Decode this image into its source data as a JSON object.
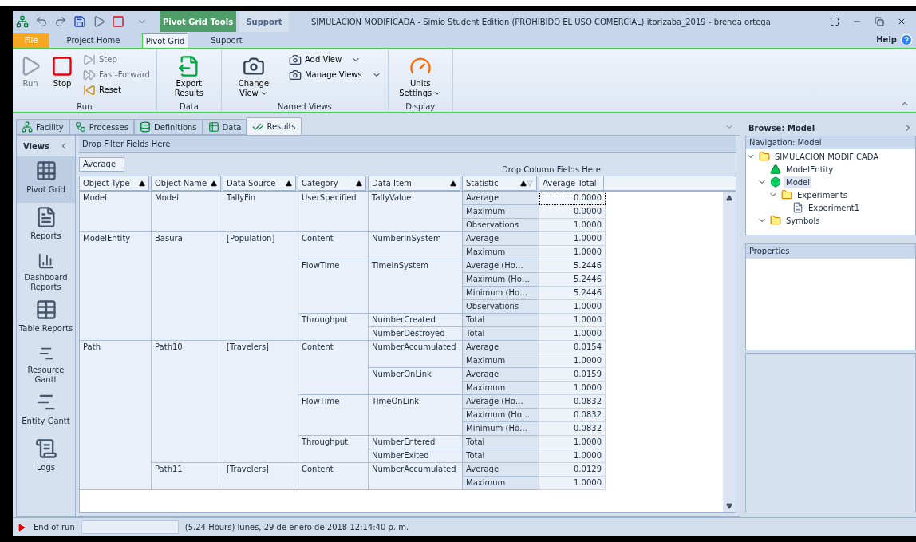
{
  "window": {
    "title": "SIMULACION MODIFICADA - Simio Student Edition (PROHIBIDO EL USO COMERCIAL) itorizaba_2019 - brenda ortega",
    "context_tabs": [
      "Pivot Grid Tools",
      "Support"
    ],
    "help": "Help"
  },
  "ribbon_tabs": [
    {
      "label": "File",
      "kind": "file",
      "selected": false
    },
    {
      "label": "Project Home",
      "kind": "tab",
      "selected": false
    },
    {
      "label": "Pivot Grid",
      "kind": "tab",
      "selected": true
    },
    {
      "label": "Support",
      "kind": "tab",
      "selected": false
    }
  ],
  "ribbon_groups": [
    {
      "label": "Run",
      "items": [
        {
          "kind": "big",
          "label": "Run",
          "disabled": true
        },
        {
          "kind": "big",
          "label": "Stop",
          "disabled": false
        },
        {
          "kind": "stack",
          "items": [
            {
              "label": "Step",
              "disabled": true
            },
            {
              "label": "Fast-Forward",
              "disabled": true
            },
            {
              "label": "Reset",
              "disabled": false
            }
          ]
        }
      ]
    },
    {
      "label": "Data",
      "items": [
        {
          "kind": "big",
          "label": "Export Results",
          "disabled": false
        }
      ]
    },
    {
      "label": "Named Views",
      "items": [
        {
          "kind": "big",
          "label": "Change View",
          "disabled": false,
          "dropdown": true
        },
        {
          "kind": "stack",
          "items": [
            {
              "label": "Add View",
              "disabled": false,
              "dropdown": true
            },
            {
              "label": "Manage Views",
              "disabled": false,
              "dropdown": true
            }
          ]
        }
      ]
    },
    {
      "label": "Display",
      "items": [
        {
          "kind": "big",
          "label": "Units Settings",
          "disabled": false,
          "dropdown": true
        }
      ]
    }
  ],
  "doc_tabs": [
    {
      "label": "Facility",
      "selected": false
    },
    {
      "label": "Processes",
      "selected": false
    },
    {
      "label": "Definitions",
      "selected": false
    },
    {
      "label": "Data",
      "selected": false
    },
    {
      "label": "Results",
      "selected": true
    }
  ],
  "views": {
    "title": "Views",
    "items": [
      {
        "label": "Pivot Grid",
        "selected": true
      },
      {
        "label": "Reports",
        "selected": false
      },
      {
        "label": "Dashboard Reports",
        "selected": false
      },
      {
        "label": "Table Reports",
        "selected": false
      },
      {
        "label": "Resource Gantt",
        "selected": false
      },
      {
        "label": "Entity Gantt",
        "selected": false
      },
      {
        "label": "Logs",
        "selected": false
      }
    ]
  },
  "pivot": {
    "filter_area": "Drop Filter Fields Here",
    "data_field": "Average",
    "column_area": "Drop Column Fields Here",
    "row_fields": [
      "Object Type",
      "Object Name",
      "Data Source",
      "Category",
      "Data Item",
      "Statistic"
    ],
    "total_header": "Average Total",
    "rows": [
      {
        "label": "Model",
        "children": [
          {
            "label": "Model",
            "children": [
              {
                "label": "TallyFin",
                "children": [
                  {
                    "label": "UserSpecified",
                    "children": [
                      {
                        "label": "TallyValue",
                        "stats": [
                          {
                            "label": "Average",
                            "value": "0.0000",
                            "selected": true
                          },
                          {
                            "label": "Maximum",
                            "value": "0.0000",
                            "selected": false
                          },
                          {
                            "label": "Observations",
                            "value": "1.0000",
                            "selected": false
                          }
                        ]
                      }
                    ]
                  }
                ]
              }
            ]
          }
        ]
      },
      {
        "label": "ModelEntity",
        "children": [
          {
            "label": "Basura",
            "children": [
              {
                "label": "[Population]",
                "children": [
                  {
                    "label": "Content",
                    "children": [
                      {
                        "label": "NumberInSystem",
                        "stats": [
                          {
                            "label": "Average",
                            "value": "1.0000",
                            "selected": false
                          },
                          {
                            "label": "Maximum",
                            "value": "1.0000",
                            "selected": false
                          }
                        ]
                      }
                    ]
                  },
                  {
                    "label": "FlowTime",
                    "children": [
                      {
                        "label": "TimeInSystem",
                        "stats": [
                          {
                            "label": "Average (Ho…",
                            "value": "5.2446",
                            "selected": false
                          },
                          {
                            "label": "Maximum (Ho…",
                            "value": "5.2446",
                            "selected": false
                          },
                          {
                            "label": "Minimum (Ho…",
                            "value": "5.2446",
                            "selected": false
                          },
                          {
                            "label": "Observations",
                            "value": "1.0000",
                            "selected": false
                          }
                        ]
                      }
                    ]
                  },
                  {
                    "label": "Throughput",
                    "children": [
                      {
                        "label": "NumberCreated",
                        "stats": [
                          {
                            "label": "Total",
                            "value": "1.0000",
                            "selected": false
                          }
                        ]
                      },
                      {
                        "label": "NumberDestroyed",
                        "stats": [
                          {
                            "label": "Total",
                            "value": "1.0000",
                            "selected": false
                          }
                        ]
                      }
                    ]
                  }
                ]
              }
            ]
          }
        ]
      },
      {
        "label": "Path",
        "children": [
          {
            "label": "Path10",
            "children": [
              {
                "label": "[Travelers]",
                "children": [
                  {
                    "label": "Content",
                    "children": [
                      {
                        "label": "NumberAccumulated",
                        "stats": [
                          {
                            "label": "Average",
                            "value": "0.0154",
                            "selected": false
                          },
                          {
                            "label": "Maximum",
                            "value": "1.0000",
                            "selected": false
                          }
                        ]
                      },
                      {
                        "label": "NumberOnLink",
                        "stats": [
                          {
                            "label": "Average",
                            "value": "0.0159",
                            "selected": false
                          },
                          {
                            "label": "Maximum",
                            "value": "1.0000",
                            "selected": false
                          }
                        ]
                      }
                    ]
                  },
                  {
                    "label": "FlowTime",
                    "children": [
                      {
                        "label": "TimeOnLink",
                        "stats": [
                          {
                            "label": "Average (Ho…",
                            "value": "0.0832",
                            "selected": false
                          },
                          {
                            "label": "Maximum (Ho…",
                            "value": "0.0832",
                            "selected": false
                          },
                          {
                            "label": "Minimum (Ho…",
                            "value": "0.0832",
                            "selected": false
                          }
                        ]
                      }
                    ]
                  },
                  {
                    "label": "Throughput",
                    "children": [
                      {
                        "label": "NumberEntered",
                        "stats": [
                          {
                            "label": "Total",
                            "value": "1.0000",
                            "selected": false
                          }
                        ]
                      },
                      {
                        "label": "NumberExited",
                        "stats": [
                          {
                            "label": "Total",
                            "value": "1.0000",
                            "selected": false
                          }
                        ]
                      }
                    ]
                  }
                ]
              }
            ]
          },
          {
            "label": "Path11",
            "children": [
              {
                "label": "[Travelers]",
                "children": [
                  {
                    "label": "Content",
                    "children": [
                      {
                        "label": "NumberAccumulated",
                        "stats": [
                          {
                            "label": "Average",
                            "value": "0.0129",
                            "selected": false
                          },
                          {
                            "label": "Maximum",
                            "value": "1.0000",
                            "selected": false
                          }
                        ]
                      }
                    ]
                  }
                ]
              }
            ]
          }
        ]
      }
    ]
  },
  "browse": {
    "title": "Browse: Model",
    "navigation_title": "Navigation: Model",
    "tree": [
      {
        "label": "SIMULACION MODIFICADA",
        "kind": "folder",
        "expanded": true,
        "selected": false,
        "children": [
          {
            "label": "ModelEntity",
            "kind": "entity",
            "selected": false
          },
          {
            "label": "Model",
            "kind": "model",
            "expanded": true,
            "selected": true,
            "children": [
              {
                "label": "Experiments",
                "kind": "folder",
                "expanded": true,
                "selected": false,
                "children": [
                  {
                    "label": "Experiment1",
                    "kind": "experiment",
                    "selected": false
                  }
                ]
              }
            ]
          },
          {
            "label": "Symbols",
            "kind": "folder",
            "expanded": true,
            "selected": false
          }
        ]
      }
    ],
    "properties_title": "Properties"
  },
  "status_bar": {
    "run_state": "End of run",
    "time": "(5.24 Hours) lunes, 29 de enero de 2018 12:14:40 p. m."
  }
}
